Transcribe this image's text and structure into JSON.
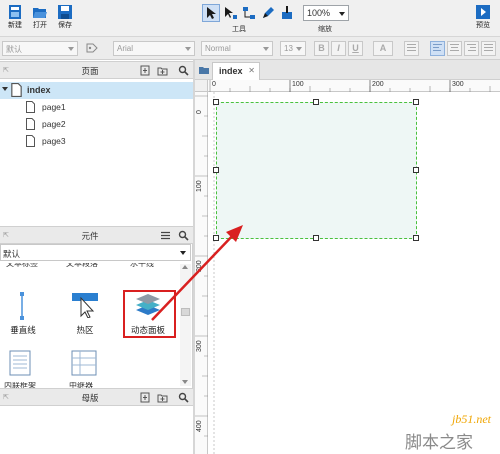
{
  "toolbar": {
    "new_label": "新建",
    "open_label": "打开",
    "save_label": "保存",
    "tools_label": "工具",
    "zoom_value": "100%",
    "zoom_label": "缩放",
    "preview_label": "预览"
  },
  "formatbar": {
    "style_value": "默认",
    "font_value": "Arial",
    "weight_value": "Normal",
    "size_value": "13",
    "bold": "B",
    "italic": "I",
    "underline": "U",
    "font_color": "A"
  },
  "pages_panel": {
    "title": "页面",
    "pages": [
      "index",
      "page1",
      "page2",
      "page3"
    ]
  },
  "widgets_panel": {
    "title": "元件",
    "library": "默认",
    "cut_labels": [
      "文本标签",
      "文本段落",
      "水平线"
    ],
    "widgets": [
      "垂直线",
      "热区",
      "动态面板"
    ],
    "bottom_labels": [
      "内联框架",
      "中继器"
    ]
  },
  "masters_panel": {
    "title": "母版"
  },
  "canvas": {
    "tab_label": "index",
    "tab_close": "✕",
    "h_ticks": [
      "0",
      "100",
      "200",
      "300"
    ],
    "v_ticks": [
      "0",
      "100",
      "200",
      "300",
      "400"
    ]
  },
  "watermark": {
    "site": "jb51.net",
    "name": "脚本之家"
  },
  "colors": {
    "accent": "#1c6cc2",
    "highlight_red": "#d92020",
    "selection_green": "#49c13d"
  }
}
